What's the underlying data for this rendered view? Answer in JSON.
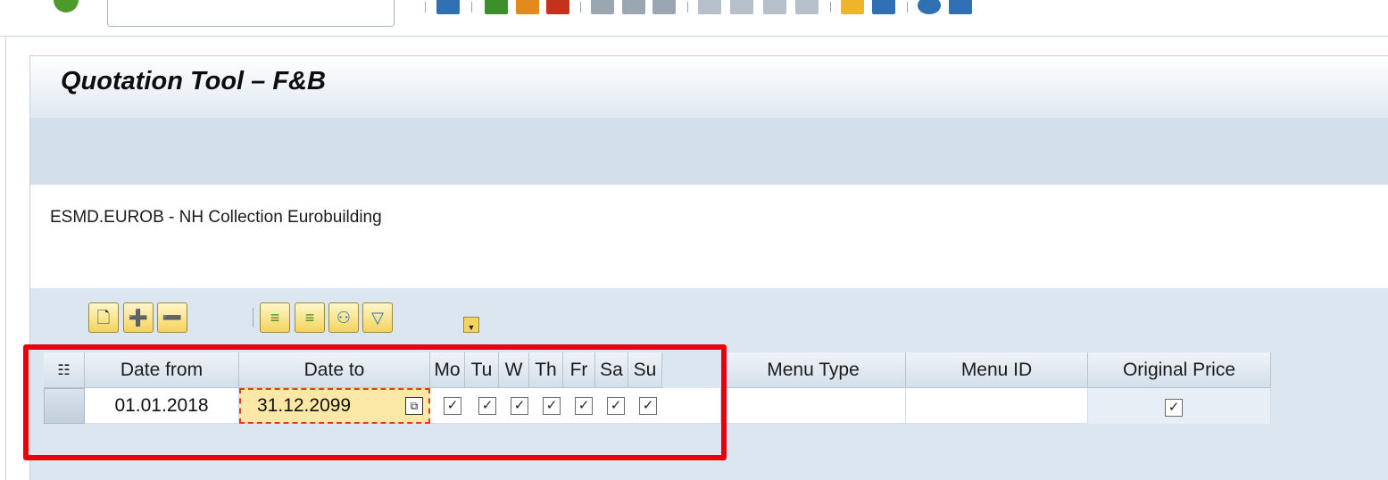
{
  "toolbar": {
    "command_field_value": "",
    "icons": [
      "enter-icon",
      "save-icon",
      "back-icon",
      "exit-icon",
      "cancel-icon",
      "print-icon",
      "find-icon",
      "find-next-icon",
      "first-page-icon",
      "previous-page-icon",
      "next-page-icon",
      "last-page-icon",
      "create-session-icon",
      "shortcut-icon",
      "help-icon",
      "customize-layout-icon"
    ]
  },
  "page": {
    "title": "Quotation Tool – F&B",
    "hotel_label": "ESMD.EUROB - NH Collection Eurobuilding"
  },
  "grid_toolbar": {
    "icons": [
      "new-row-icon",
      "append-row-icon",
      "delete-row-icon",
      "sort-ascending-icon",
      "sort-descending-icon",
      "find-icon",
      "filter-icon"
    ]
  },
  "grid": {
    "columns": [
      "Date from",
      "Date to",
      "Mo",
      "Tu",
      "W",
      "Th",
      "Fr",
      "Sa",
      "Su",
      "Menu Type",
      "Menu ID",
      "Original Price"
    ],
    "rows": [
      {
        "date_from": "01.01.2018",
        "date_to": "31.12.2099",
        "mo": true,
        "tu": true,
        "w": true,
        "th": true,
        "fr": true,
        "sa": true,
        "su": true,
        "menu_type": "",
        "menu_id": "",
        "original_price": true
      }
    ],
    "check_glyph": "✓"
  },
  "colors": {
    "highlight": "#e8000b",
    "focus_cell": "#fbe7a6",
    "header_bg": "#dfe8f1"
  }
}
